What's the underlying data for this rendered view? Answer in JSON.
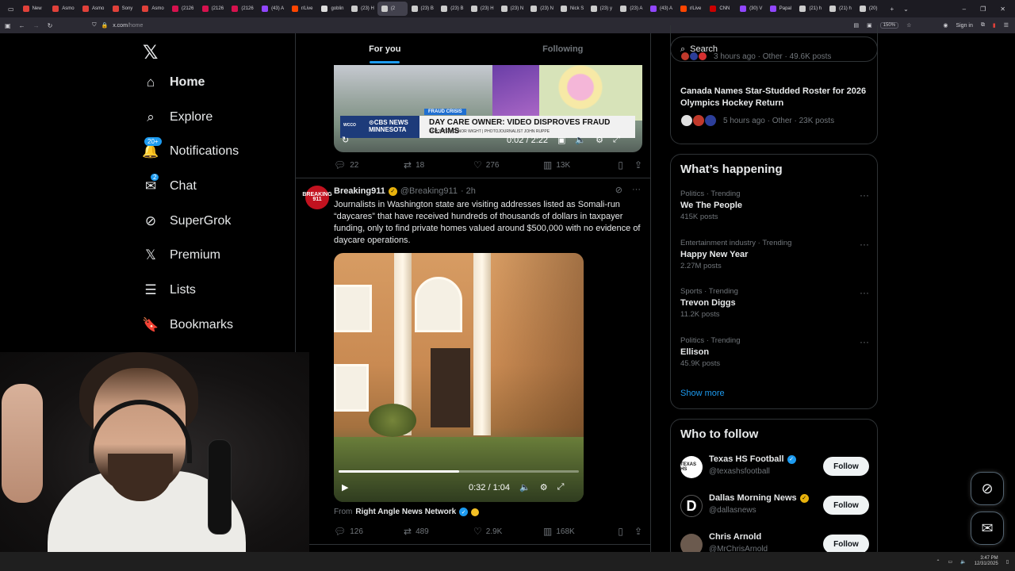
{
  "browser": {
    "tabs": [
      {
        "label": "New",
        "color": "#e0413a"
      },
      {
        "label": "Asmo",
        "color": "#e0413a"
      },
      {
        "label": "Asmo",
        "color": "#e0413a"
      },
      {
        "label": "Sony",
        "color": "#e0413a"
      },
      {
        "label": "Asmo",
        "color": "#e0413a"
      },
      {
        "label": "(2126",
        "color": "#d6124e"
      },
      {
        "label": "(2126",
        "color": "#d6124e"
      },
      {
        "label": "(2126",
        "color": "#d6124e"
      },
      {
        "label": "(43) A",
        "color": "#9146ff"
      },
      {
        "label": "r/Live",
        "color": "#ff4500"
      },
      {
        "label": "goblin",
        "color": "#dddddd"
      },
      {
        "label": "(23) H",
        "color": "#cccccc"
      },
      {
        "label": "(2",
        "color": "#cccccc"
      },
      {
        "label": "(23) B",
        "color": "#cccccc"
      },
      {
        "label": "(23) B",
        "color": "#cccccc"
      },
      {
        "label": "(23) H",
        "color": "#cccccc"
      },
      {
        "label": "(23) N",
        "color": "#cccccc"
      },
      {
        "label": "(23) N",
        "color": "#cccccc"
      },
      {
        "label": "Nick S",
        "color": "#cccccc"
      },
      {
        "label": "(23) y",
        "color": "#cccccc"
      },
      {
        "label": "(23) A",
        "color": "#cccccc"
      },
      {
        "label": "(43) A",
        "color": "#9146ff"
      },
      {
        "label": "r/Live",
        "color": "#ff4500"
      },
      {
        "label": "CNN",
        "color": "#cc0000"
      },
      {
        "label": "(30) V",
        "color": "#9146ff"
      },
      {
        "label": "Papal",
        "color": "#9146ff"
      },
      {
        "label": "(21) h",
        "color": "#cccccc"
      },
      {
        "label": "(21) h",
        "color": "#cccccc"
      },
      {
        "label": "(20)",
        "color": "#cccccc"
      }
    ],
    "new_tab": "+",
    "tab_list": "⌄",
    "window_controls": {
      "minimize": "–",
      "restore": "❐",
      "close": "✕"
    },
    "url_host": "x.com",
    "url_path": "/home",
    "zoom": "150%",
    "sign_in": "Sign in"
  },
  "nav": {
    "logo": "𝕏",
    "items": [
      {
        "label": "Home",
        "icon": "⌂",
        "badge": ""
      },
      {
        "label": "Explore",
        "icon": "⌕",
        "badge": ""
      },
      {
        "label": "Notifications",
        "icon": "🔔",
        "badge": "20+"
      },
      {
        "label": "Chat",
        "icon": "✉",
        "badge": "2"
      },
      {
        "label": "SuperGrok",
        "icon": "⊘",
        "badge": ""
      },
      {
        "label": "Premium",
        "icon": "𝕏",
        "badge": ""
      },
      {
        "label": "Lists",
        "icon": "☰",
        "badge": ""
      },
      {
        "label": "Bookmarks",
        "icon": "🔖",
        "badge": ""
      }
    ]
  },
  "feed": {
    "tabs": [
      "For you",
      "Following"
    ],
    "post1": {
      "video": {
        "station": "WCCO",
        "network": "⊙CBS NEWS",
        "region": "MINNESOTA",
        "tag": "FRAUD CRISIS",
        "headline": "DAY CARE OWNER: VIDEO DISPROVES FRAUD CLAIMS",
        "subline": "REPORTER CONOR WIGHT | PHOTOJOURNALIST JOHN RUPPE",
        "time": "0:02 / 2:22"
      },
      "stats": {
        "replies": "22",
        "reposts": "18",
        "likes": "276",
        "views": "13K"
      }
    },
    "post2": {
      "avatar_text": "BREAKING 911",
      "name": "Breaking911",
      "handle": "@Breaking911",
      "time": "· 2h",
      "text": "Journalists in Washington state are visiting addresses listed as Somali-run “daycares” that have received hundreds of thousands of dollars in taxpayer funding, only to find private homes valued around $500,000 with no evidence of daycare operations.",
      "video": {
        "time": "0:32 / 1:04",
        "progress": 0.5
      },
      "from_prefix": "From",
      "from_source": "Right Angle News Network",
      "stats": {
        "replies": "126",
        "reposts": "489",
        "likes": "2.9K",
        "views": "168K"
      }
    }
  },
  "right": {
    "search_placeholder": "Search",
    "news_top_meta": "3 hours ago · Other · 49.6K posts",
    "news_title": "Canada Names Star-Studded Roster for 2026 Olympics Hockey Return",
    "news_meta": "5 hours ago · Other · 23K posts",
    "happening_title": "What’s happening",
    "trends": [
      {
        "category": "Politics · Trending",
        "title": "We The People",
        "posts": "415K posts"
      },
      {
        "category": "Entertainment industry · Trending",
        "title": "Happy New Year",
        "posts": "2.27M posts"
      },
      {
        "category": "Sports · Trending",
        "title": "Trevon Diggs",
        "posts": "11.2K posts"
      },
      {
        "category": "Politics · Trending",
        "title": "Ellison",
        "posts": "45.9K posts"
      }
    ],
    "show_more": "Show more",
    "follow_title": "Who to follow",
    "follow": [
      {
        "name": "Texas HS Football",
        "handle": "@texashsfootball",
        "avatar_text": "TEXAS HS",
        "badge": "blue",
        "button": "Follow"
      },
      {
        "name": "Dallas Morning News",
        "handle": "@dallasnews",
        "avatar_text": "D",
        "badge": "gold",
        "button": "Follow"
      },
      {
        "name": "Chris Arnold",
        "handle": "@MrChrisArnold",
        "avatar_text": "",
        "badge": "",
        "button": "Follow"
      }
    ]
  },
  "fabs": {
    "grok": "⊘",
    "messages": "✉"
  },
  "taskbar": {
    "time": "3:47 PM",
    "date": "12/31/2025",
    "tray": "⌃"
  }
}
